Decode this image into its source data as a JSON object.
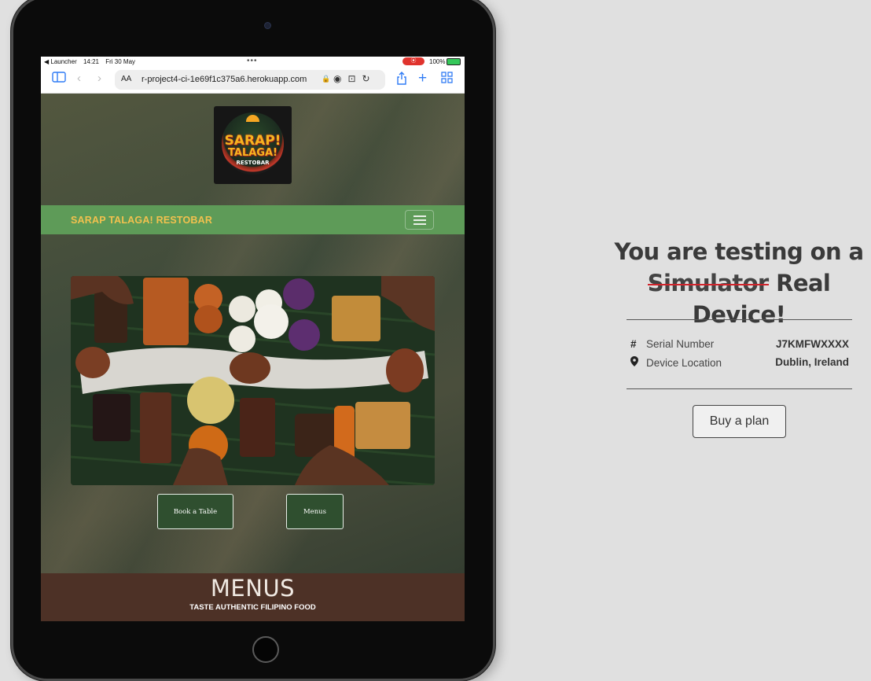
{
  "statusbar": {
    "back_app": "◀ Launcher",
    "time": "14:21",
    "date": "Fri 30 May",
    "dots": "•••",
    "battery": "100%"
  },
  "browser": {
    "aa_label": "AA",
    "url": "r-project4-ci-1e69f1c375a6.herokuapp.com"
  },
  "site": {
    "logo": {
      "line1": "SARAP!",
      "line2": "TALAGA!",
      "line3": "RESTOBAR"
    },
    "brand": "SARAP TALAGA! RESTOBAR",
    "buttons": {
      "book": "Book a Table",
      "menus": "Menus"
    },
    "menus_section": {
      "title": "MENUS",
      "subtitle": "TASTE AUTHENTIC FILIPINO FOOD"
    }
  },
  "panel": {
    "headline_line1": "You are testing on a",
    "strikethrough": "Simulator",
    "headline_rest": "Real Device!",
    "rows": [
      {
        "icon": "#",
        "label": "Serial Number",
        "value": "J7KMFWXXXX"
      },
      {
        "icon": "📍",
        "label": "Device Location",
        "value": "Dublin, Ireland"
      }
    ],
    "buy_button": "Buy a plan"
  },
  "colors": {
    "navbar": "#5e9b58",
    "brand": "#f2c14e",
    "menus_bg": "#4d3126",
    "strike": "#d0232b"
  }
}
